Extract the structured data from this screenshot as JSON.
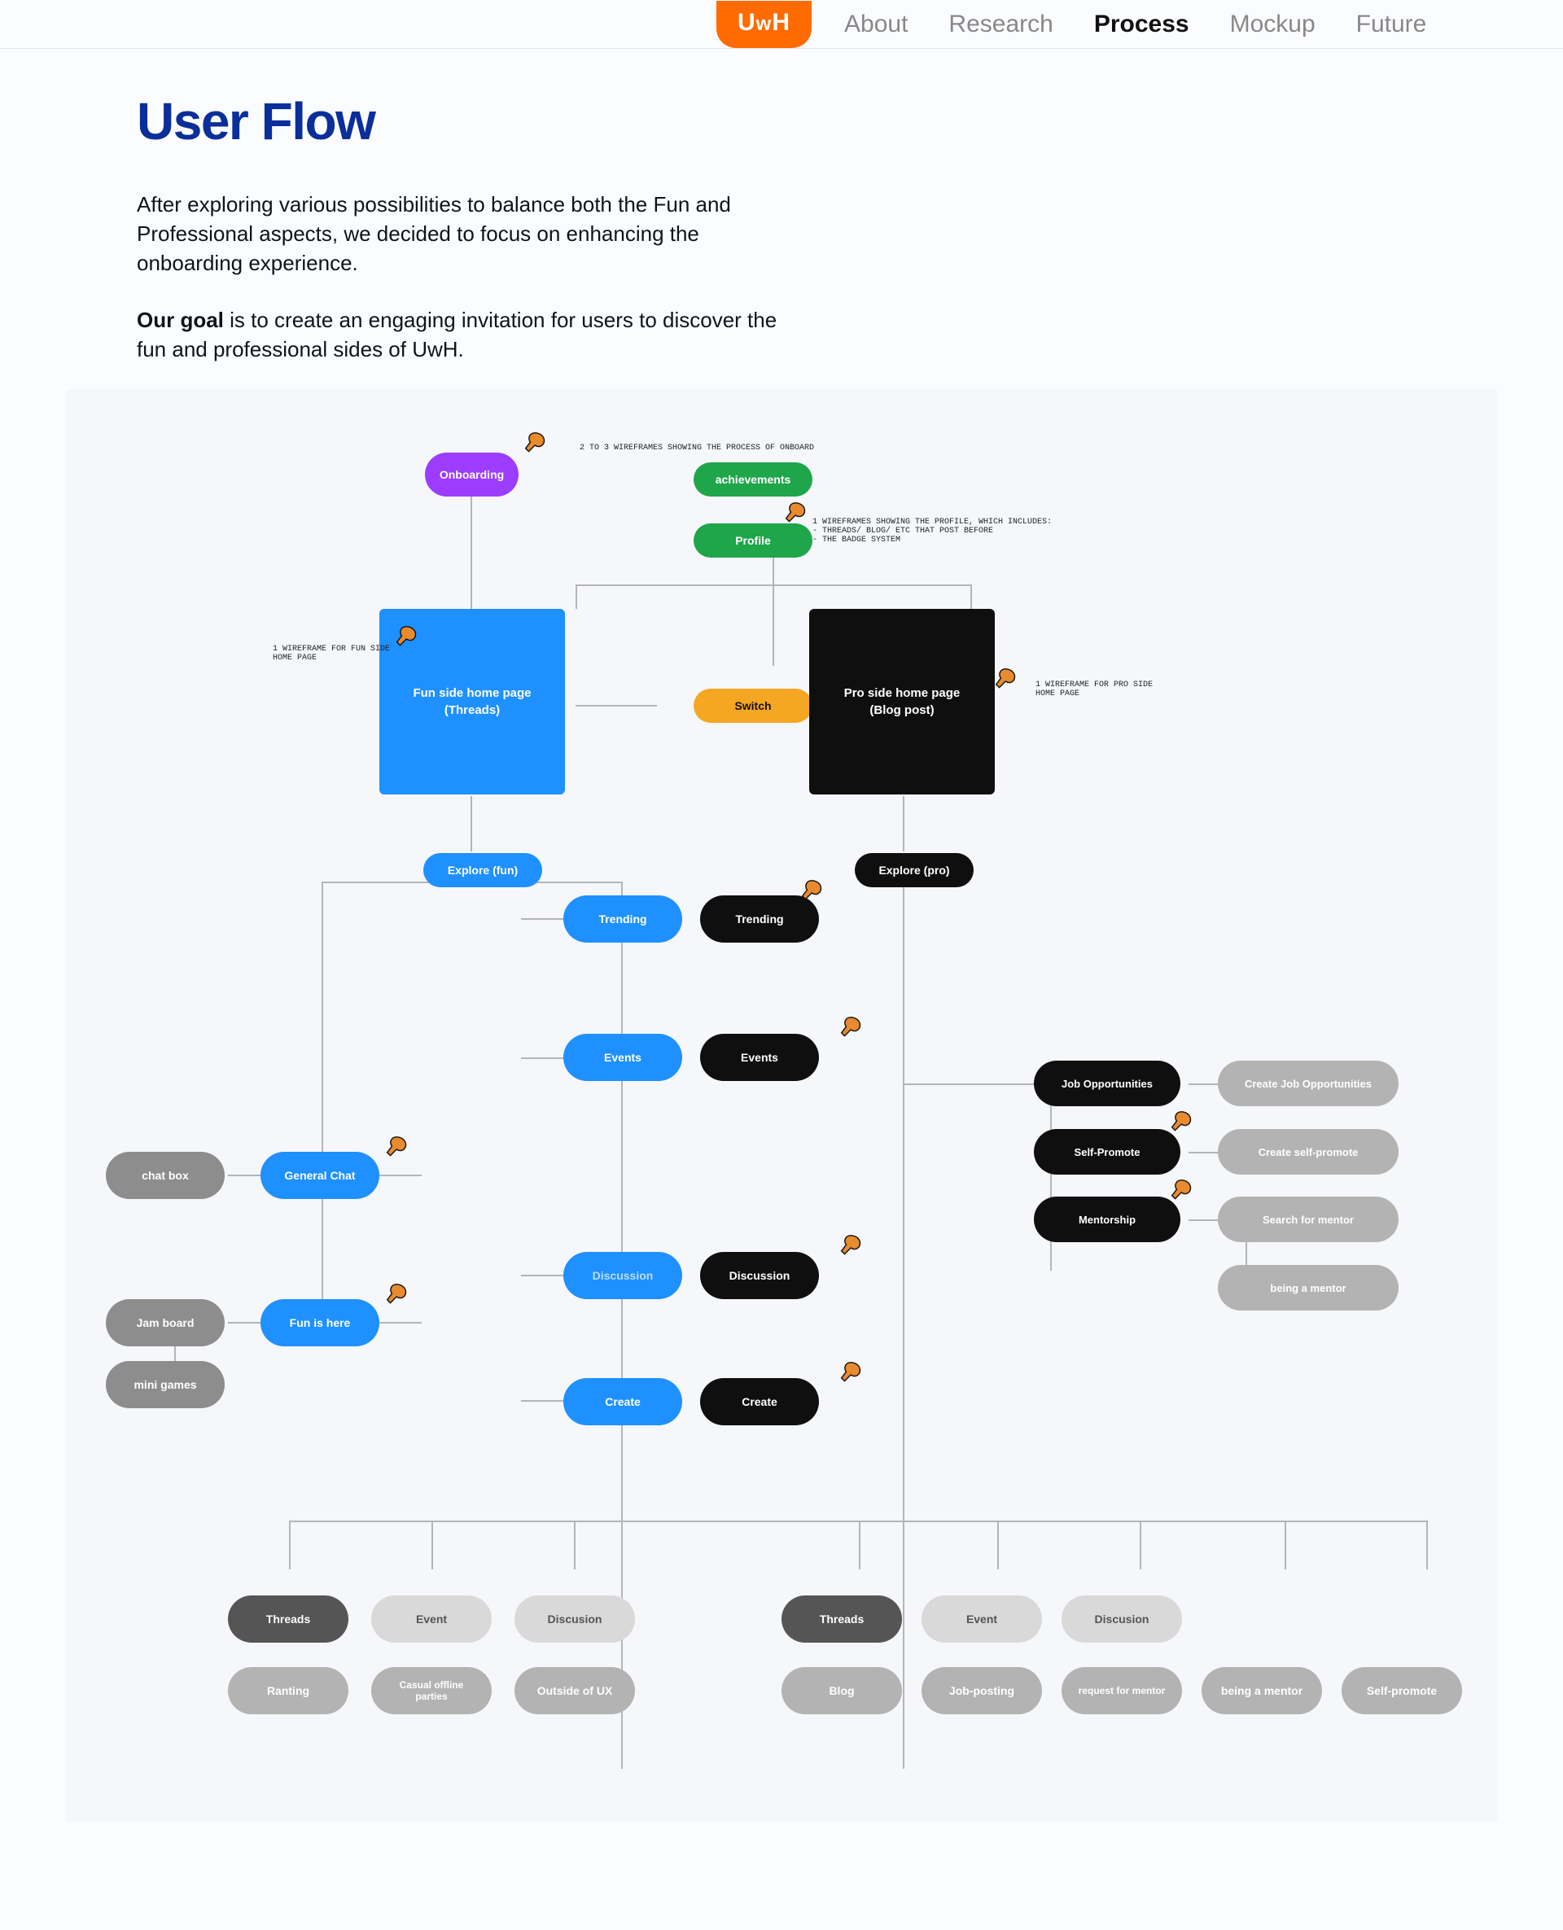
{
  "nav": {
    "logo": "UwH",
    "links": [
      "About",
      "Research",
      "Process",
      "Mockup",
      "Future"
    ],
    "active": "Process"
  },
  "header": {
    "title": "User Flow",
    "intro": "After exploring various possibilities to balance both the Fun and Professional aspects, we decided to focus on enhancing the onboarding experience.",
    "goal_label": "Our goal",
    "goal_text": " is to create an engaging invitation for users to discover the fun and professional sides of UwH."
  },
  "notes": {
    "onboard": "2 TO 3 WIREFRAMES SHOWING THE PROCESS OF ONBOARD",
    "profile": "1 WIREFRAMES SHOWING THE PROFILE, WHICH INCLUDES:\n- THREADS/ BLOG/ ETC THAT POST BEFORE\n- THE BADGE SYSTEM",
    "fun_home": "1 WIREFRAME FOR FUN SIDE\nHOME PAGE",
    "pro_home": "1 WIREFRAME FOR PRO SIDE\nHOME PAGE"
  },
  "nodes": {
    "onboarding": "Onboarding",
    "achievements": "achievements",
    "profile": "Profile",
    "switch": "Switch",
    "fun_home_l1": "Fun side home page",
    "fun_home_l2": "(Threads)",
    "pro_home_l1": "Pro side home page",
    "pro_home_l2": "(Blog post)",
    "explore_fun": "Explore (fun)",
    "explore_pro": "Explore (pro)",
    "trending_fun": "Trending",
    "trending_pro": "Trending",
    "events_fun": "Events",
    "events_pro": "Events",
    "discussion_fun": "Discussion",
    "discussion_pro": "Discussion",
    "create_fun": "Create",
    "create_pro": "Create",
    "chat_box": "chat box",
    "general_chat": "General Chat",
    "jam_board": "Jam board",
    "mini_games": "mini games",
    "fun_is_here": "Fun is here",
    "job_opps": "Job Opportunities",
    "create_job_opps": "Create Job Opportunities",
    "self_promote": "Self-Promote",
    "create_self_promote": "Create self-promote",
    "mentorship": "Mentorship",
    "search_mentor": "Search for mentor",
    "being_mentor": "being a mentor"
  },
  "bottom": {
    "fun": [
      "Threads",
      "Event",
      "Discusion",
      "Ranting",
      "Casual offline parties",
      "Outside of UX"
    ],
    "pro": [
      "Threads",
      "Event",
      "Discusion",
      "Blog",
      "Job-posting",
      "request for mentor",
      "being a mentor",
      "Self-promote"
    ]
  }
}
